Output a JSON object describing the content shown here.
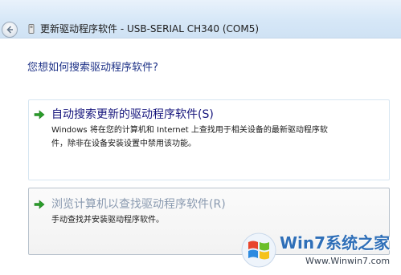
{
  "window": {
    "title": "更新驱动程序软件 - USB-SERIAL CH340 (COM5)"
  },
  "page": {
    "question": "您想如何搜索驱动程序软件?"
  },
  "options": [
    {
      "title": "自动搜索更新的驱动程序软件(S)",
      "description_line1": "Windows 将在您的计算机和 Internet 上查找用于相关设备的最新驱动程序软",
      "description_line2": "件，除非在设备安装设置中禁用该功能。",
      "state": "normal"
    },
    {
      "title": "浏览计算机以查找驱动程序软件(R)",
      "description_line1": "手动查找并安装驱动程序软件。",
      "state": "hover"
    }
  ],
  "watermark": {
    "brand": "Win7系统之家",
    "url": "Www.Winwin7.com"
  },
  "colors": {
    "title_blue": "#1e3287",
    "option_title": "#15147c",
    "option_title_dim": "#8a9ab0",
    "arrow_green": "#2a9d2a"
  },
  "icons": {
    "back": "back-arrow-icon",
    "device": "device-icon",
    "option_arrow": "green-arrow-icon",
    "logo": "windows-logo-icon"
  }
}
